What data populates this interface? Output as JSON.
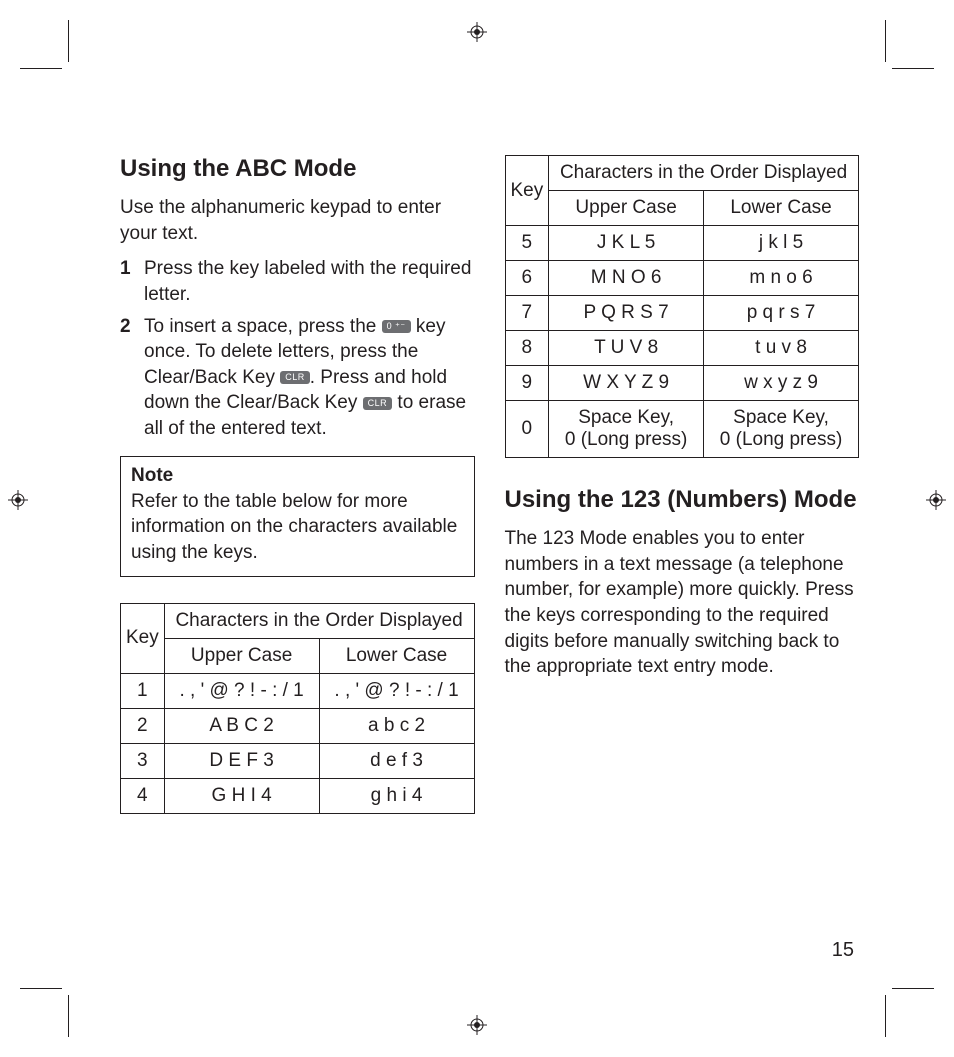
{
  "left": {
    "heading": "Using the ABC Mode",
    "intro": "Use the alphanumeric keypad to enter your text.",
    "steps": [
      {
        "n": "1",
        "before": "Press the key labeled with the required letter.",
        "icons": []
      },
      {
        "n": "2",
        "segments": [
          "To insert a space, press the ",
          {
            "icon": "0 ⁺⁻"
          },
          " key once. To delete letters, press the Clear/Back Key ",
          {
            "icon": "CLR"
          },
          ". Press and hold down the Clear/Back Key ",
          {
            "icon": "CLR"
          },
          " to erase all of the entered text."
        ]
      }
    ],
    "note_title": "Note",
    "note_body": "Refer to the table below for more information on the characters available using the keys.",
    "table": {
      "head_key": "Key",
      "head_span": "Characters in the Order Displayed",
      "head_upper": "Upper Case",
      "head_lower": "Lower Case",
      "rows": [
        {
          "k": "1",
          "u": ". , ' @ ? ! - : / 1",
          "l": ". , ' @ ? ! - : / 1"
        },
        {
          "k": "2",
          "u": "A B C 2",
          "l": "a b c 2"
        },
        {
          "k": "3",
          "u": "D E F 3",
          "l": "d e f 3"
        },
        {
          "k": "4",
          "u": "G H I 4",
          "l": "g h i 4"
        }
      ]
    }
  },
  "right": {
    "table": {
      "head_key": "Key",
      "head_span": "Characters in the Order Displayed",
      "head_upper": "Upper Case",
      "head_lower": "Lower Case",
      "rows": [
        {
          "k": "5",
          "u": "J K L 5",
          "l": "j k l 5"
        },
        {
          "k": "6",
          "u": "M N O 6",
          "l": "m n o 6"
        },
        {
          "k": "7",
          "u": "P Q R S 7",
          "l": "p q r s 7"
        },
        {
          "k": "8",
          "u": "T U V 8",
          "l": "t u v 8"
        },
        {
          "k": "9",
          "u": "W X Y Z 9",
          "l": "w x y z 9"
        },
        {
          "k": "0",
          "u": "Space Key,\n0 (Long press)",
          "l": "Space Key,\n0 (Long press)"
        }
      ]
    },
    "heading": "Using the 123 (Numbers) Mode",
    "body": "The 123 Mode enables you to enter numbers in a text message (a telephone number, for example) more quickly. Press the keys corresponding to the required digits before manually switching back to the appropriate text entry mode."
  },
  "page_number": "15"
}
